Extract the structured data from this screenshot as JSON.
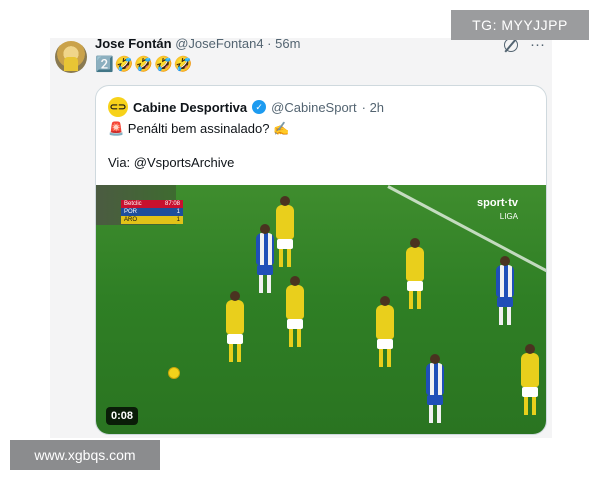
{
  "watermarks": {
    "top_right": "TG: MYYJJPP",
    "bottom_left": "www.xgbqs.com"
  },
  "tweet": {
    "author_name": "Jose Fontán",
    "author_handle": "@JoseFontan4",
    "time": " · 56m",
    "text": "2️⃣🤣🤣🤣🤣",
    "more_icon": "···"
  },
  "quoted_tweet": {
    "avatar_glyph": "⊂⊃",
    "author_name": "Cabine Desportiva",
    "verified_glyph": "✓",
    "author_handle": "@CabineSport",
    "time": " · 2h",
    "line1": "🚨 Penálti bem assinalado? ✍️",
    "line2": "Via: @VsportsArchive",
    "video": {
      "duration": "0:08",
      "broadcaster": "sport·tv",
      "broadcaster_sub": "LIGA",
      "scoreboard": {
        "sponsor": "Betclic",
        "clock": "87:08",
        "team1": "POR",
        "score1": "1",
        "team2": "ARO",
        "score2": "1"
      }
    }
  },
  "colors": {
    "verified": "#1d9bf0",
    "pitch": "#2f7f25",
    "yellow_kit": "#e9cf1c",
    "blue_kit": "#1f4fb8"
  }
}
